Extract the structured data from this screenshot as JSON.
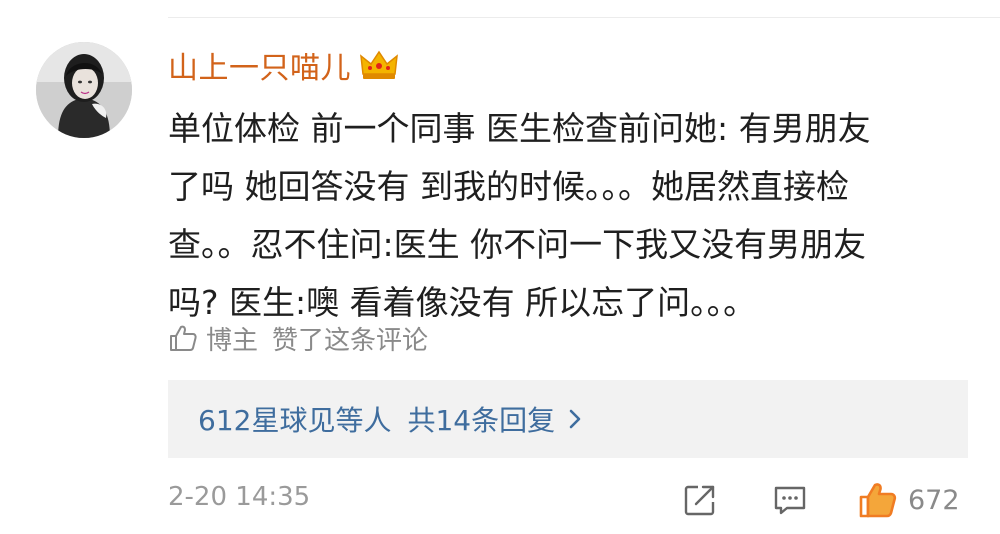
{
  "comment": {
    "username": "山上一只喵儿",
    "text_lines": [
      "单位体检 前一个同事 医生检查前问她: 有男朋友",
      "了吗 她回答没有 到我的时候。。。她居然直接检",
      "查。。忍不住问:医生 你不问一下我又没有男朋友",
      "吗? 医生:噢 看着像没有 所以忘了问。。。"
    ],
    "liked_by_author": {
      "author_label": "博主",
      "liked_text": "赞了这条评论"
    },
    "replies": {
      "names_text": "612星球见等人",
      "count_text": "共14条回复",
      "chevron": ">"
    },
    "timestamp": "2-20 14:35",
    "like_count": "672"
  },
  "icons": {
    "crown": "crown-icon",
    "small_thumb": "thumbs-up-outline-icon",
    "share": "share-icon",
    "comment": "comment-icon",
    "like": "thumbs-up-icon"
  },
  "colors": {
    "username": "#d2631a",
    "reply_link": "#3f6d9e",
    "like_accent": "#f07c23",
    "muted_text": "#8a8a8a"
  }
}
